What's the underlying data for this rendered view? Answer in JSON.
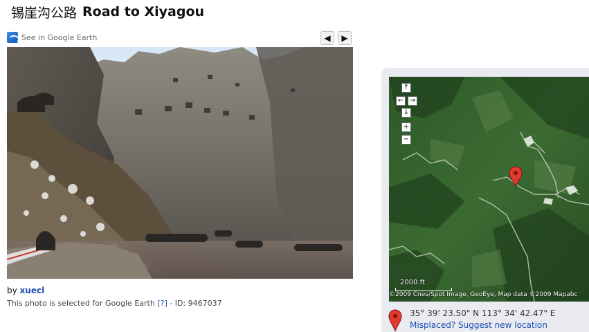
{
  "page": {
    "title_cn": "锡崖沟公路",
    "title_en": "Road to Xiyagou"
  },
  "photo_toolbar": {
    "google_earth_label": "See in Google Earth",
    "prev_icon": "◀",
    "next_icon": "▶"
  },
  "photo_meta": {
    "by_prefix": "by",
    "author": "xuecl",
    "selected_text": "This photo is selected for Google Earth",
    "help_text": "[?]",
    "id_text": "- ID: 9467037"
  },
  "map": {
    "controls": {
      "up": "↑",
      "left": "←",
      "right": "→",
      "down": "↓",
      "zoom_in": "+",
      "zoom_out": "−"
    },
    "scale_label": "2000 ft",
    "credit": "©2009 Cnes/Spot Image, GeoEye, Map data ©2009 Mapabc",
    "coordinates": "35° 39' 23.50\" N  113° 34' 42.47\" E",
    "misplaced_link": "Misplaced? Suggest new location",
    "pin_color": "#e23a2e"
  },
  "colors": {
    "link": "#1b4fb5",
    "map_panel_bg": "#e9ebf1"
  }
}
